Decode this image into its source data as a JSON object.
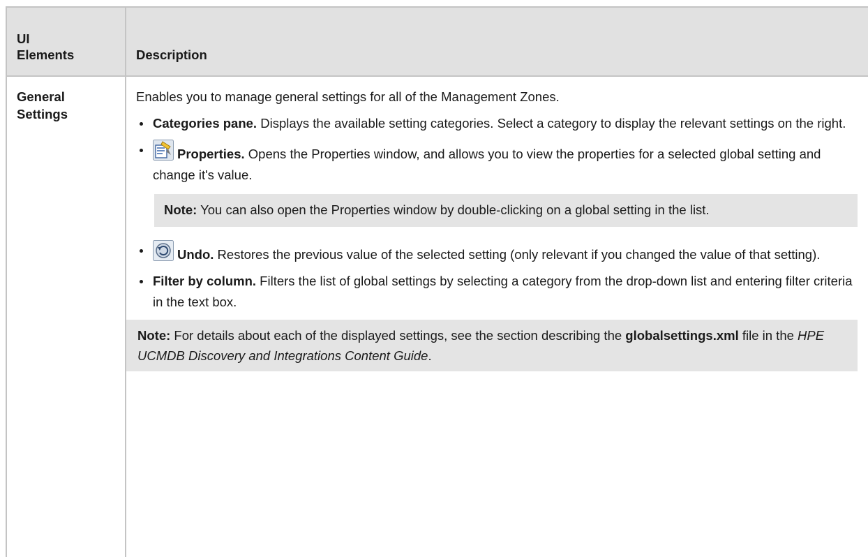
{
  "table": {
    "header_col1": "UI Elements",
    "header_col2": "Description"
  },
  "row": {
    "element": "General Settings",
    "intro": "Enables you to manage general settings for all of the Management Zones.",
    "items": [
      {
        "bold": "Categories pane.",
        "text": " Displays the available setting categories. Select a category to display the relevant settings on the right."
      },
      {
        "icon": "properties-icon",
        "bold": "Properties.",
        "text": " Opens the Properties window, and allows you to view the properties for a selected global setting and change it's value."
      },
      {
        "icon": "undo-icon",
        "bold": "Undo.",
        "text": " Restores the previous value of the selected setting (only relevant if you changed the value of that setting)."
      },
      {
        "bold": "Filter by column.",
        "text": " Filters the list of global settings by selecting a category from the drop-down list and entering filter criteria in the text box."
      }
    ],
    "note1": {
      "label": "Note:",
      "text": " You can also open the Properties window by double-clicking on a global setting in the list."
    },
    "note2": {
      "label": "Note:",
      "text1": " For details about each of the displayed settings, see the section describing the ",
      "file": "globalsettings.xml",
      "text2": " file in the ",
      "guide": "HPE UCMDB Discovery and Integrations Content Guide",
      "text3": "."
    }
  },
  "colors": {
    "header_bg": "#e1e1e1",
    "note_bg": "#e4e4e4",
    "border": "#c4c4c4"
  }
}
